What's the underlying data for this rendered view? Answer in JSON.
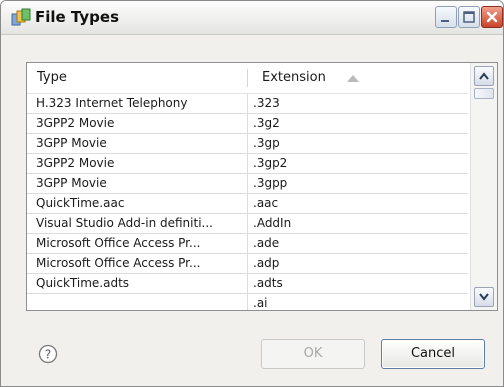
{
  "window": {
    "title": "File Types",
    "icon": "file-types-icon"
  },
  "titlebar_buttons": [
    "minimize-icon",
    "maximize-icon",
    "close-icon"
  ],
  "colors": {
    "titlebar_close": "#c9432a",
    "default_button_border": "#5f7fa8",
    "disabled_text": "#a8a8a8"
  },
  "table": {
    "columns": [
      {
        "label": "Type"
      },
      {
        "label": "Extension",
        "sort": "ascending"
      }
    ],
    "rows": [
      {
        "type": "H.323 Internet Telephony",
        "ext": ".323"
      },
      {
        "type": "3GPP2 Movie",
        "ext": ".3g2"
      },
      {
        "type": "3GPP Movie",
        "ext": ".3gp"
      },
      {
        "type": "3GPP2 Movie",
        "ext": ".3gp2"
      },
      {
        "type": "3GPP Movie",
        "ext": ".3gpp"
      },
      {
        "type": "QuickTime.aac",
        "ext": ".aac"
      },
      {
        "type": "Visual Studio Add-in definiti...",
        "ext": ".AddIn"
      },
      {
        "type": "Microsoft Office Access Pr...",
        "ext": ".ade"
      },
      {
        "type": "Microsoft Office Access Pr...",
        "ext": ".adp"
      },
      {
        "type": "QuickTime.adts",
        "ext": ".adts"
      },
      {
        "type": "",
        "ext": ".ai"
      }
    ],
    "scroll_position": 0.0
  },
  "footer": {
    "help_icon": "help-icon",
    "ok_label": "OK",
    "ok_enabled": false,
    "cancel_label": "Cancel"
  }
}
